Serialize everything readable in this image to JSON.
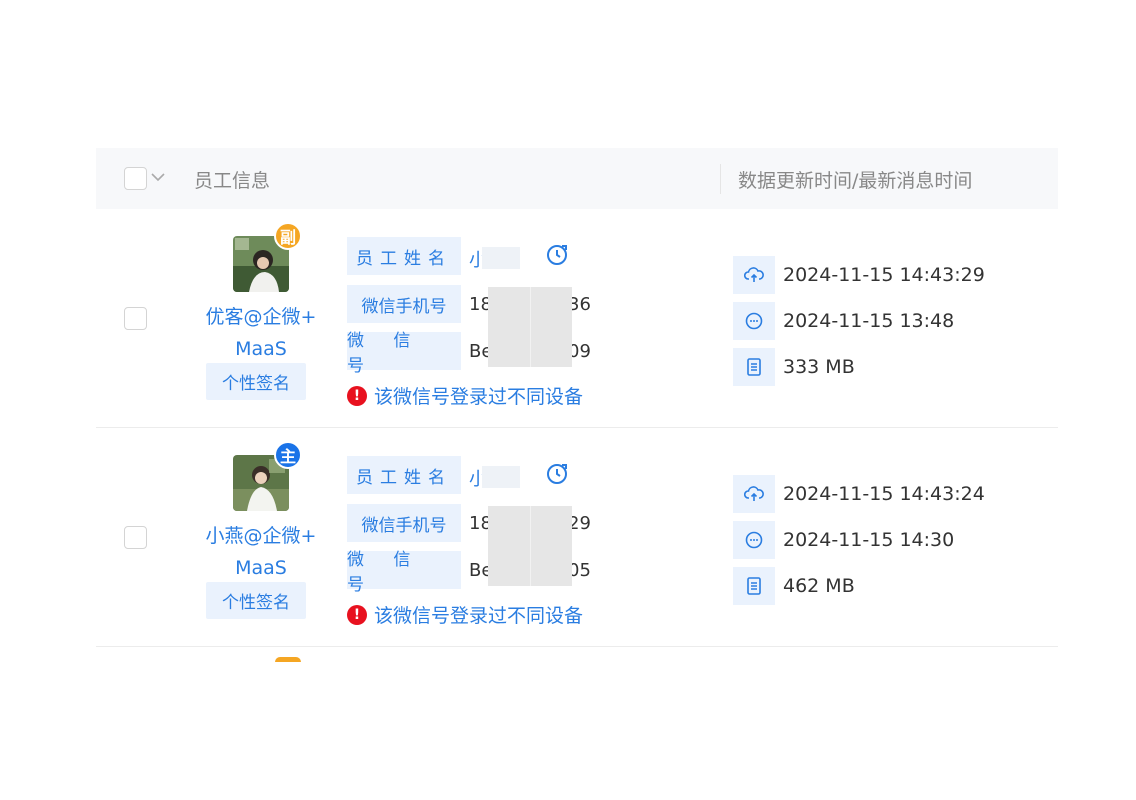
{
  "header": {
    "col_employee": "员工信息",
    "col_time": "数据更新时间/最新消息时间"
  },
  "rows": [
    {
      "badge": "副",
      "name_line1": "优客@企微+",
      "name_line2": "MaaS",
      "signature_button": "个性签名",
      "label_name": "员工姓名",
      "value_name": "小",
      "label_phone": "微信手机号",
      "value_phone_head": "18",
      "value_phone_tail": "36",
      "label_wechat": "微 信 号",
      "value_wechat_head": "Be",
      "value_wechat_tail": "09",
      "warning": "该微信号登录过不同设备",
      "update_time": "2024-11-15 14:43:29",
      "message_time": "2024-11-15 13:48",
      "storage": "333 MB"
    },
    {
      "badge": "主",
      "name_line1": "小燕@企微+",
      "name_line2": "MaaS",
      "signature_button": "个性签名",
      "label_name": "员工姓名",
      "value_name": "小",
      "label_phone": "微信手机号",
      "value_phone_head": "18",
      "value_phone_tail": "29",
      "label_wechat": "微 信 号",
      "value_wechat_head": "Be",
      "value_wechat_tail": "05",
      "warning": "该微信号登录过不同设备",
      "update_time": "2024-11-15 14:43:24",
      "message_time": "2024-11-15 14:30",
      "storage": "462 MB"
    }
  ],
  "colors": {
    "accent": "#2a7de1",
    "label_bg": "#eaf2fd",
    "badge_secondary": "#f5a623",
    "badge_primary": "#1a73e8",
    "warning": "#e8111f"
  },
  "icons": [
    "checkbox",
    "chevron-down-icon",
    "clock-icon",
    "warning-icon",
    "cloud-upload-icon",
    "chat-bubble-icon",
    "storage-icon"
  ]
}
